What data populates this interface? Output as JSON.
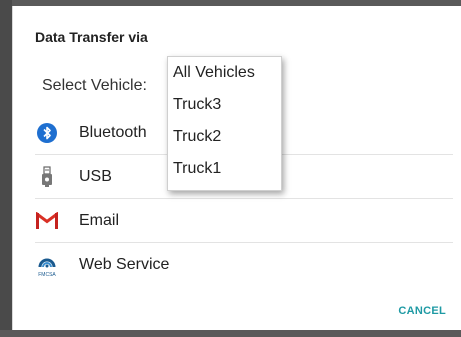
{
  "dialog": {
    "title": "Data Transfer via",
    "select_label": "Select Vehicle:",
    "options": [
      {
        "label": "Bluetooth",
        "icon": "bluetooth-icon"
      },
      {
        "label": "USB",
        "icon": "usb-icon"
      },
      {
        "label": "Email",
        "icon": "gmail-icon"
      },
      {
        "label": "Web Service",
        "icon": "fmcsa-icon"
      }
    ],
    "cancel_label": "CANCEL",
    "fmcsa_text": "FMCSA"
  },
  "vehicle_dropdown": {
    "items": [
      "All Vehicles",
      "Truck3",
      "Truck2",
      "Truck1"
    ]
  },
  "colors": {
    "accent": "#1e9aa4",
    "bluetooth": "#1e6fd0",
    "gmail_red": "#d93025"
  }
}
